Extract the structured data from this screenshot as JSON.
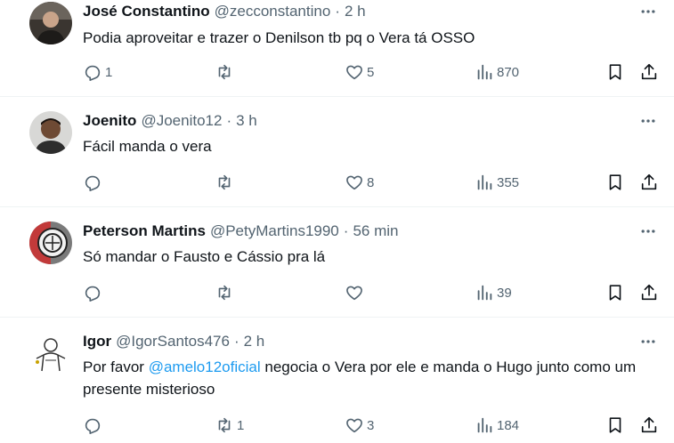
{
  "tweets": [
    {
      "name": "José Constantino",
      "handle": "@zecconstantino",
      "dot": "·",
      "time": "2 h",
      "text": "Podia aproveitar e trazer o Denilson tb pq o Vera tá OSSO",
      "replies": "1",
      "retweets": "",
      "likes": "5",
      "views": "870"
    },
    {
      "name": "Joenito",
      "handle": "@Joenito12",
      "dot": "·",
      "time": "3 h",
      "text": "Fácil manda o vera",
      "replies": "",
      "retweets": "",
      "likes": "8",
      "views": "355"
    },
    {
      "name": "Peterson Martins",
      "handle": "@PetyMartins1990",
      "dot": "·",
      "time": "56 min",
      "text": "Só mandar o Fausto e Cássio pra lá",
      "replies": "",
      "retweets": "",
      "likes": "",
      "views": "39"
    },
    {
      "name": "Igor",
      "handle": "@IgorSantos476",
      "dot": "·",
      "time": "2 h",
      "text_before": "Por favor ",
      "mention": "@amelo12oficial",
      "text_after": " negocia o Vera por ele e manda o Hugo junto como um presente misterioso",
      "replies": "",
      "retweets": "1",
      "likes": "3",
      "views": "184"
    }
  ],
  "icons": {
    "reply": "reply-icon",
    "retweet": "retweet-icon",
    "like": "like-icon",
    "views": "views-icon",
    "bookmark": "bookmark-icon",
    "share": "share-icon",
    "more": "more-icon"
  },
  "colors": {
    "text": "#0f1419",
    "secondary": "#536471",
    "mention": "#1d9bf0",
    "divider": "#eff3f4"
  }
}
